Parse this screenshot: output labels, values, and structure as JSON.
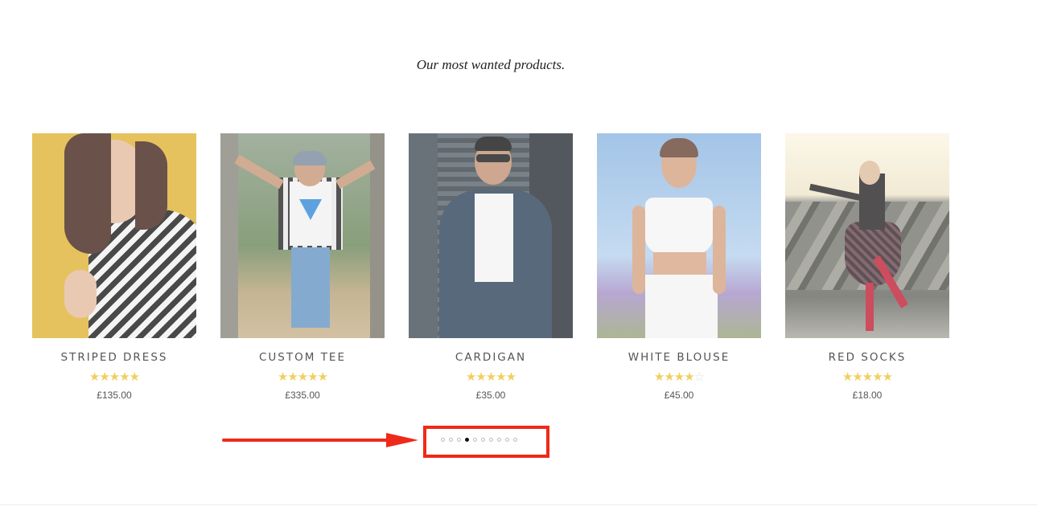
{
  "section": {
    "tagline": "Our most wanted products."
  },
  "products": [
    {
      "name": "STRIPED DRESS",
      "price": "£135.00",
      "rating": 5,
      "stars": "★★★★★"
    },
    {
      "name": "CUSTOM TEE",
      "price": "£335.00",
      "rating": 4.5,
      "stars": "★★★★★"
    },
    {
      "name": "CARDIGAN",
      "price": "£35.00",
      "rating": 5,
      "stars": "★★★★★"
    },
    {
      "name": "WHITE BLOUSE",
      "price": "£45.00",
      "rating": 4,
      "stars": "★★★★☆"
    },
    {
      "name": "RED SOCKS",
      "price": "£18.00",
      "rating": 5,
      "stars": "★★★★★"
    }
  ],
  "carousel": {
    "pages": 10,
    "active_page": 4
  },
  "colors": {
    "star": "#f1cf5f",
    "highlight": "#ee2a1a",
    "active_dot": "#111111"
  }
}
